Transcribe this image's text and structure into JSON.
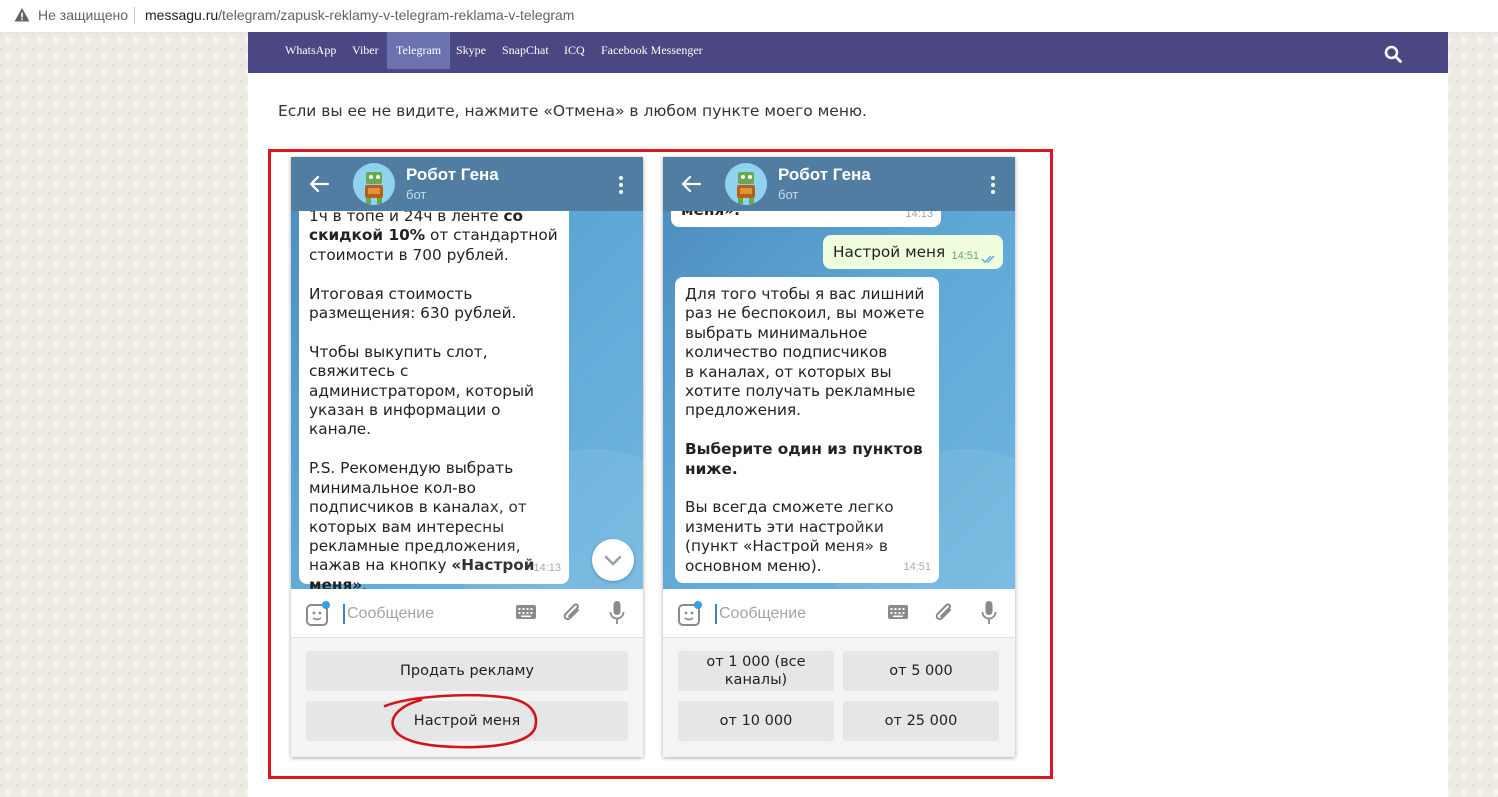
{
  "browser": {
    "insecure_label": "Не защищено",
    "url_domain": "messagu.ru",
    "url_path": "/telegram/zapusk-reklamy-v-telegram-reklama-v-telegram"
  },
  "nav": {
    "items": [
      "WhatsApp",
      "Viber",
      "Telegram",
      "Skype",
      "SnapChat",
      "ICQ",
      "Facebook Messenger"
    ],
    "active": "Telegram"
  },
  "article": {
    "text": "Если вы ее не видите, нажмите «Отмена» в любом пункте моего меню."
  },
  "phone_left": {
    "bot_name": "Робот Гена",
    "bot_status": "бот",
    "message_time": "14:13",
    "input_placeholder": "Сообщение",
    "keyboard": [
      "Продать рекламу",
      "Настрой меня"
    ],
    "highlighted_button": "Настрой меня"
  },
  "phone_right": {
    "bot_name": "Робот Гена",
    "bot_status": "бот",
    "prev_message_tail": "меня».",
    "prev_time": "14:13",
    "user_message": "Настрой меня",
    "user_time": "14:51",
    "bot_time": "14:51",
    "input_placeholder": "Сообщение",
    "keyboard": [
      "от 1 000 (все каналы)",
      "от 5 000",
      "от 10 000",
      "от 25 000"
    ]
  },
  "colors": {
    "nav_bg": "#4a4782",
    "nav_active": "#6c72b0",
    "telegram_header": "#517da2",
    "frame_red": "#e0141d"
  }
}
